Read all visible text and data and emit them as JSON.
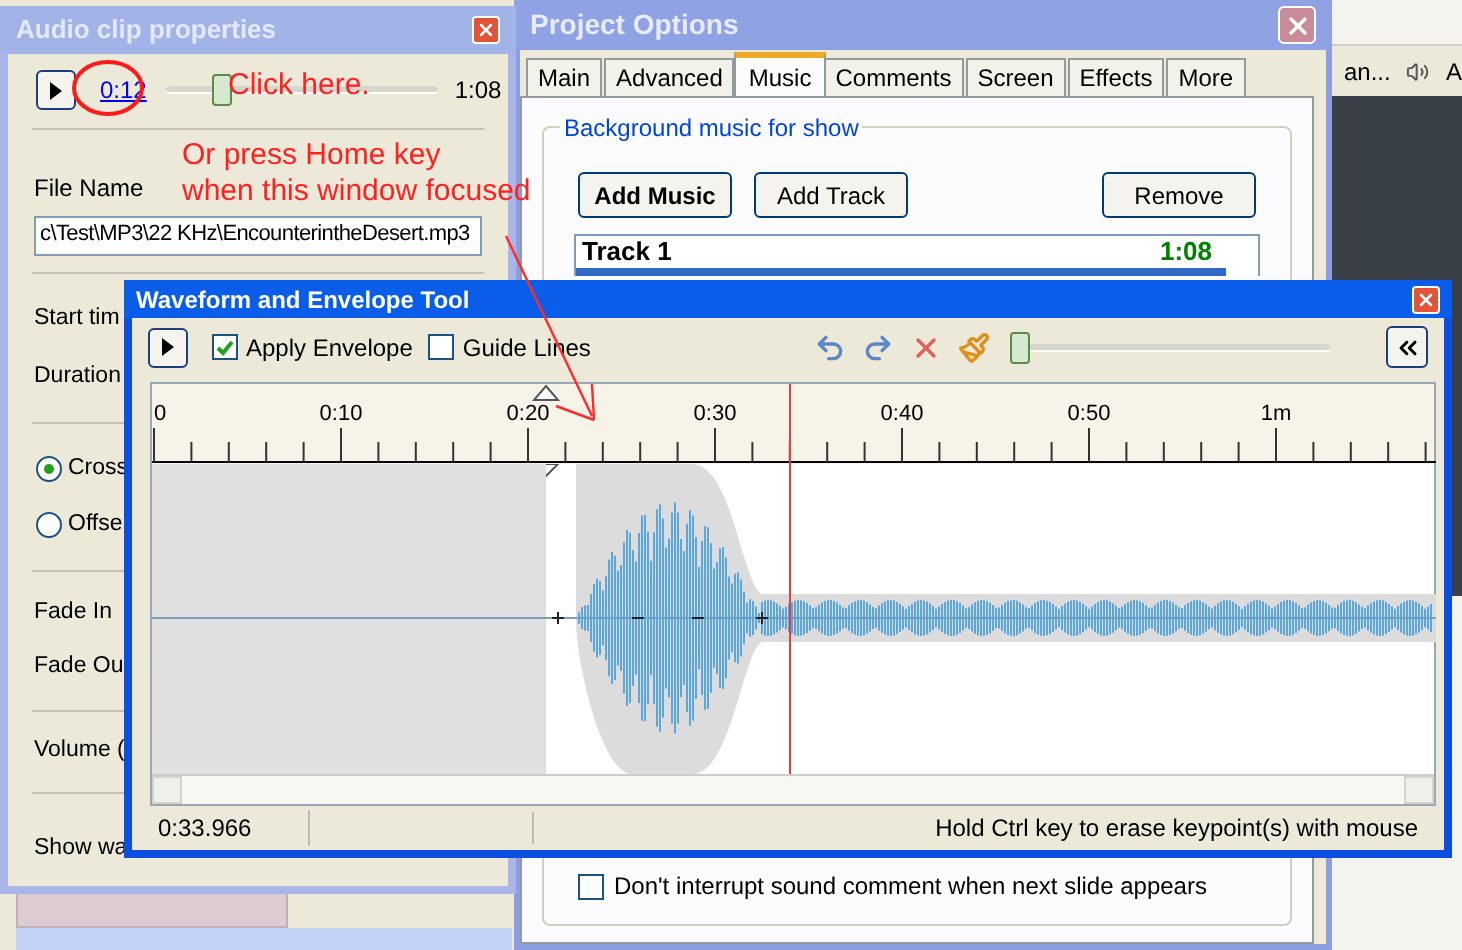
{
  "tray": {
    "text_1": "an...",
    "text_2": "A"
  },
  "audio_clip_window": {
    "title": "Audio clip properties",
    "position": "0:12",
    "duration": "1:08",
    "level": 0.18,
    "file_name_label": "File Name",
    "file_name": "c\\Test\\MP3\\22 KHz\\EncounterintheDesert.mp3",
    "fields": [
      "Start tim",
      "Duration"
    ],
    "options": [
      {
        "label": "Cross",
        "selected": true
      },
      {
        "label": "Offse",
        "selected": false
      }
    ],
    "fades": [
      "Fade In",
      "Fade Ou"
    ],
    "volume_label": "Volume (",
    "show_label": "Show wa"
  },
  "project_window": {
    "title": "Project Options",
    "tabs": [
      {
        "label": "Main",
        "selected": false
      },
      {
        "label": "Advanced",
        "selected": false
      },
      {
        "label": "Music",
        "selected": true
      },
      {
        "label": "Comments",
        "selected": false
      },
      {
        "label": "Screen",
        "selected": false
      },
      {
        "label": "Effects",
        "selected": false
      },
      {
        "label": "More",
        "selected": false
      }
    ],
    "group_title": "Background music for show",
    "buttons": [
      {
        "label": "Add Music",
        "kind": "primary"
      },
      {
        "label": "Add Track",
        "kind": "normal"
      },
      {
        "label": "Remove",
        "kind": "normal"
      }
    ],
    "track": {
      "name": "Track 1",
      "duration": "1:08"
    },
    "checkbox": {
      "label": "Don't interrupt sound comment when next slide appears",
      "checked": false
    }
  },
  "waveform_window": {
    "title": "Waveform and Envelope Tool",
    "checkboxes": [
      {
        "label": "Apply Envelope",
        "checked": true
      },
      {
        "label": "Guide Lines",
        "checked": false
      }
    ],
    "zoom_slider": {
      "level": 0.0
    },
    "ruler_labels": [
      "0",
      "0:10",
      "0:20",
      "0:30",
      "0:40",
      "0:50",
      "1m"
    ],
    "time": "0:33.966",
    "hint": "Hold Ctrl key to erase keypoint(s) with mouse"
  },
  "annotations": {
    "callout_1": "Click here.",
    "callout_2": "Or press Home key",
    "callout_3": "when this window focused"
  }
}
